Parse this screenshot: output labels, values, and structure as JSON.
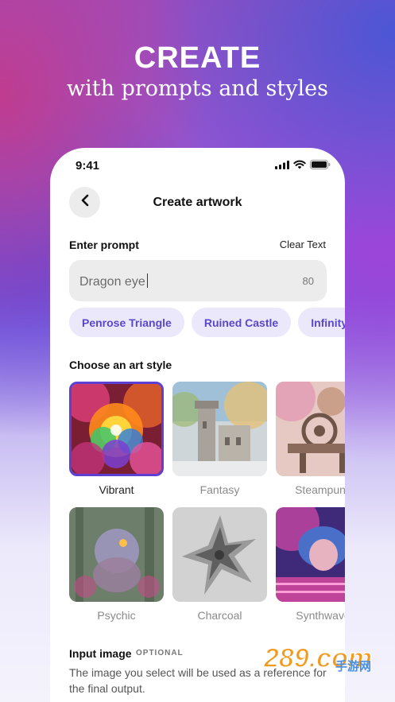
{
  "hero": {
    "title": "CREATE",
    "subtitle": "with prompts and styles"
  },
  "status_bar": {
    "time": "9:41",
    "icons": [
      "signal-icon",
      "wifi-icon",
      "battery-icon"
    ]
  },
  "header": {
    "back_icon": "chevron-left-icon",
    "title": "Create artwork"
  },
  "prompt": {
    "label": "Enter prompt",
    "clear_label": "Clear Text",
    "value": "Dragon eye",
    "count": "80"
  },
  "suggestions": [
    "Penrose Triangle",
    "Ruined Castle",
    "Infinity Loop"
  ],
  "art_style": {
    "label": "Choose an art style",
    "selected": "Vibrant",
    "items": [
      {
        "name": "Vibrant"
      },
      {
        "name": "Fantasy"
      },
      {
        "name": "Steampunk"
      },
      {
        "name": "Psychic"
      },
      {
        "name": "Charcoal"
      },
      {
        "name": "Synthwave"
      }
    ]
  },
  "input_image": {
    "label": "Input image",
    "tag": "OPTIONAL",
    "description": "The image you select will be used as a reference for the final output."
  },
  "watermark": {
    "brand": "289.com",
    "cn": "手游网"
  },
  "colors": {
    "accent": "#5d3fd3",
    "chip_bg": "#ebe8fb",
    "chip_text": "#5a47c9"
  }
}
